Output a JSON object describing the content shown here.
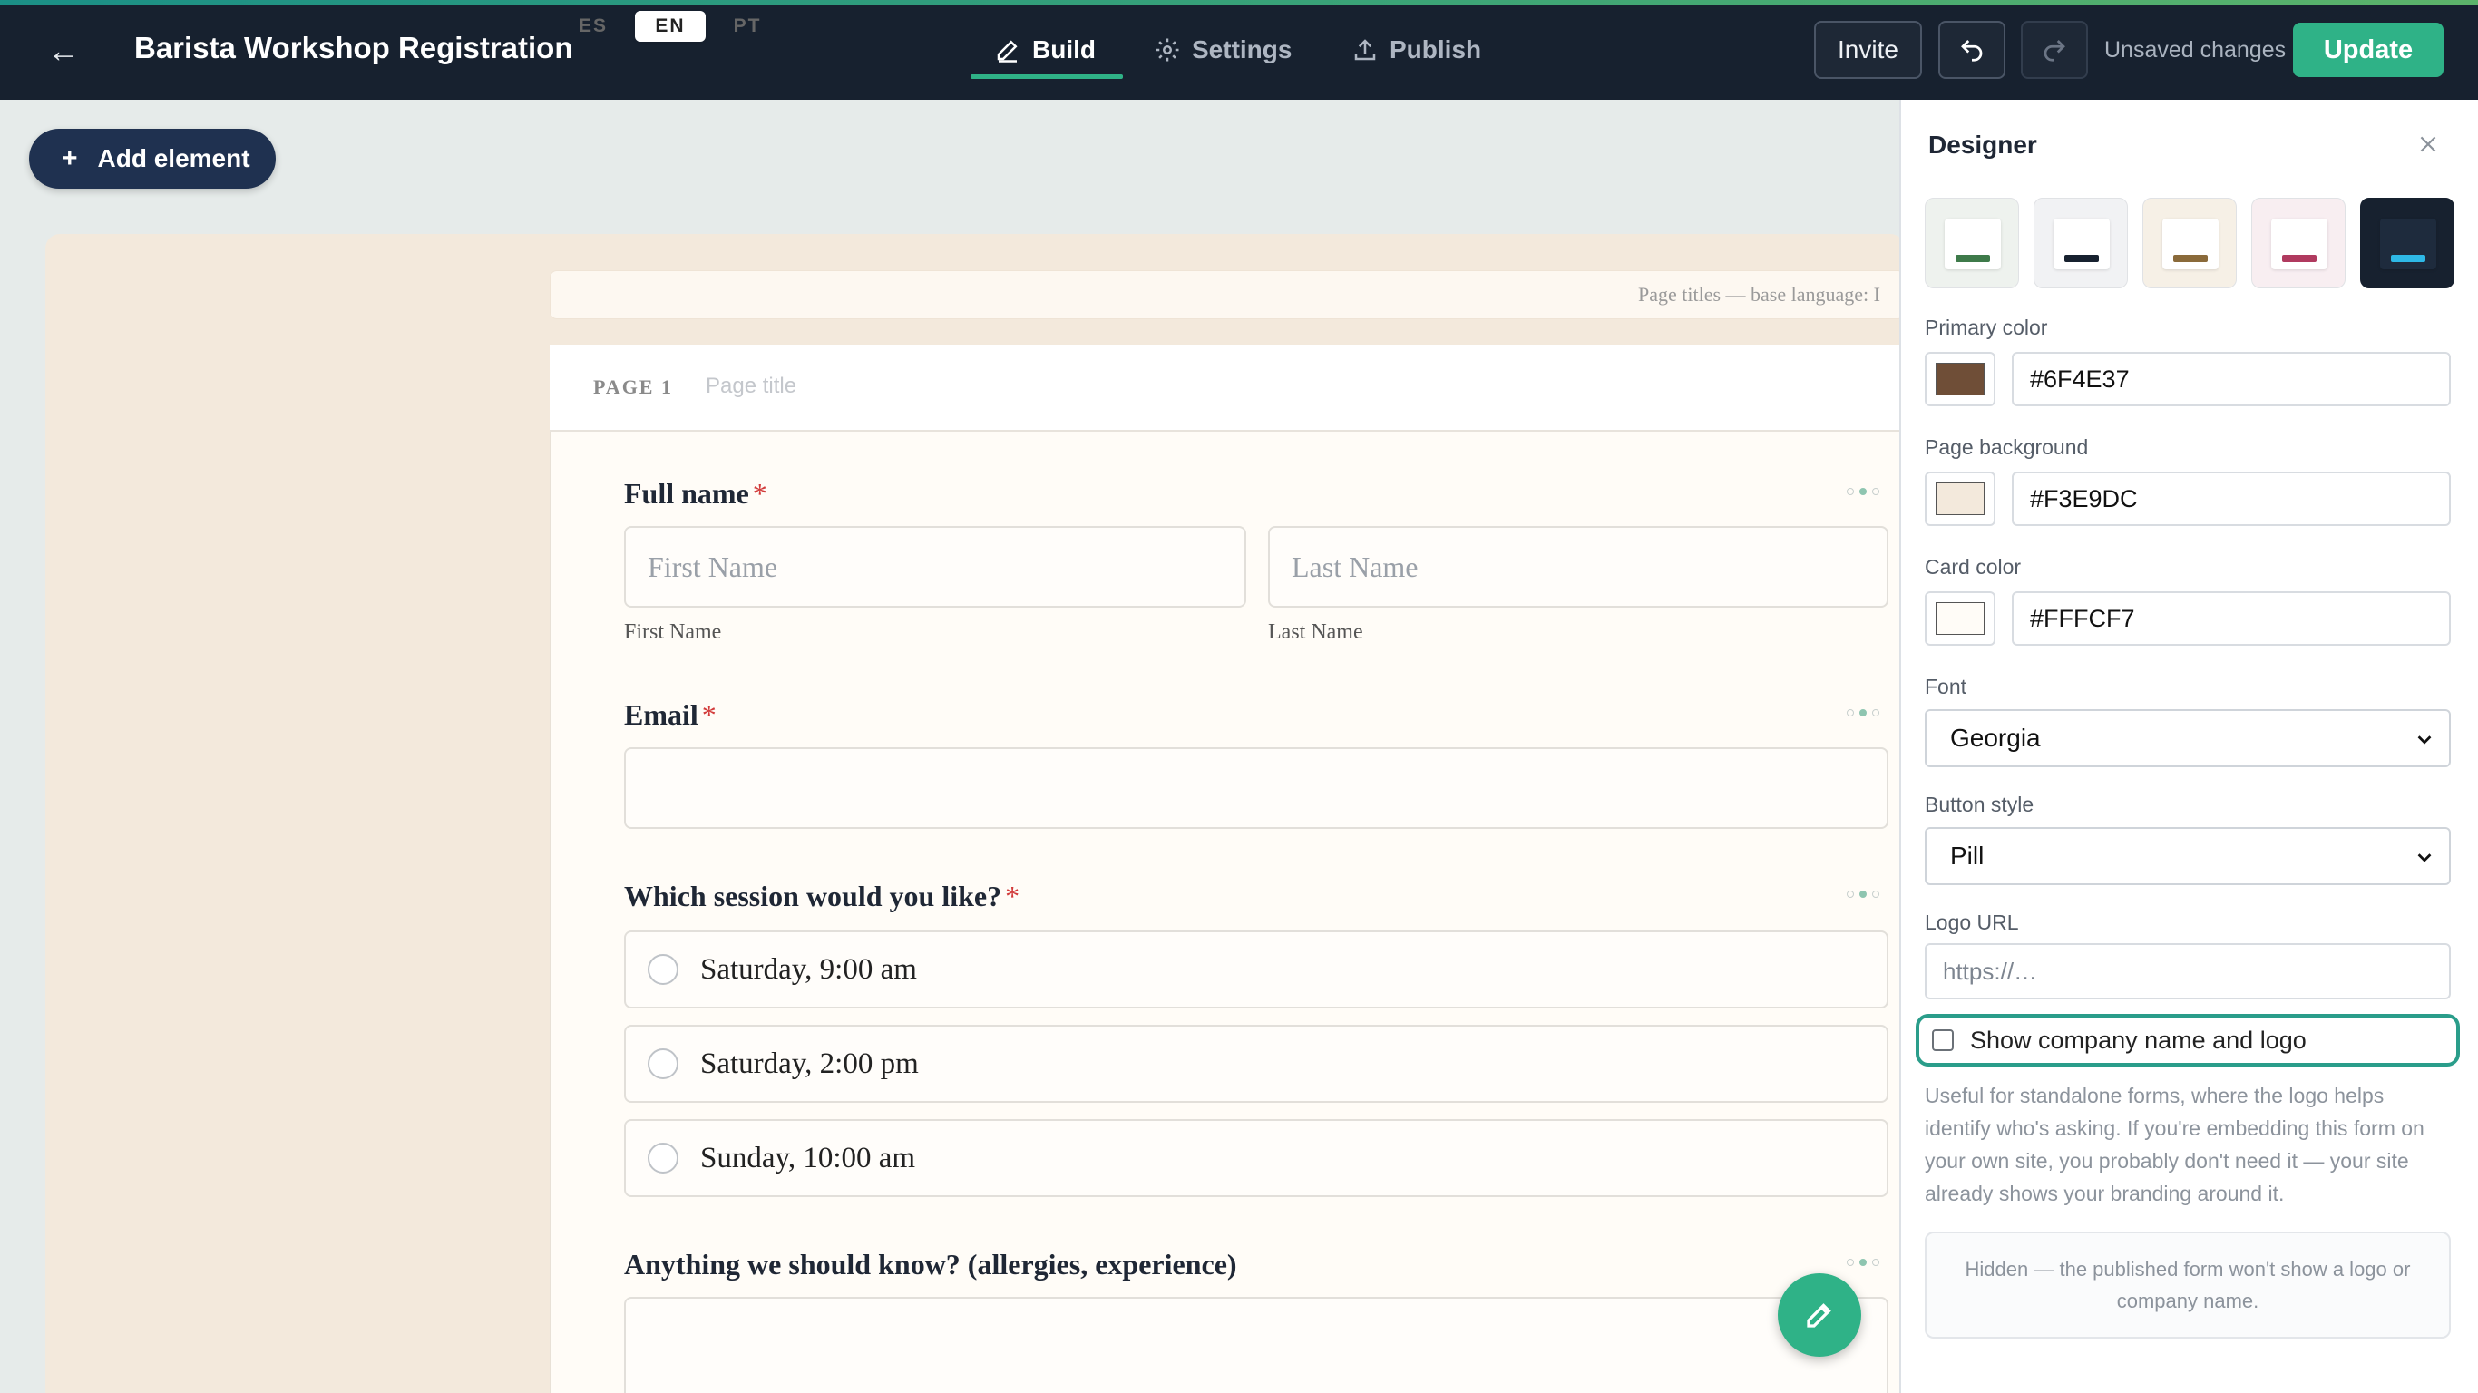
{
  "topbar": {
    "title": "Barista Workshop Registration",
    "tabs": [
      {
        "label": "Build",
        "icon": "pencil-icon",
        "active": true
      },
      {
        "label": "Settings",
        "icon": "gear-icon",
        "active": false
      },
      {
        "label": "Publish",
        "icon": "upload-icon",
        "active": false
      }
    ],
    "invite_label": "Invite",
    "unsaved_text": "Unsaved changes",
    "update_label": "Update",
    "accent_color": "#2FB287"
  },
  "toolbar": {
    "add_element_label": "Add element"
  },
  "language_bar": {
    "languages": [
      "ES",
      "EN",
      "PT"
    ],
    "active": "EN",
    "hint": "Page titles — base language: I"
  },
  "page": {
    "page_label": "PAGE 1",
    "title_placeholder": "Page title"
  },
  "form": {
    "full_name": {
      "label": "Full name",
      "required_mark": "*",
      "first_placeholder": "First Name",
      "last_placeholder": "Last Name",
      "first_sublabel": "First Name",
      "last_sublabel": "Last Name"
    },
    "email": {
      "label": "Email",
      "required_mark": "*"
    },
    "session": {
      "label": "Which session would you like?",
      "required_mark": "*",
      "options": [
        "Saturday, 9:00 am",
        "Saturday, 2:00 pm",
        "Sunday, 10:00 am"
      ]
    },
    "notes": {
      "label": "Anything we should know? (allergies, experience)"
    }
  },
  "designer": {
    "title": "Designer",
    "themes": [
      {
        "name": "green",
        "accent": "#3E7A4A",
        "bg": "#EEF2EE"
      },
      {
        "name": "dark",
        "accent": "#17212F",
        "bg": "#F1F2F4"
      },
      {
        "name": "tan",
        "accent": "#8A6A3A",
        "bg": "#F6F0E6"
      },
      {
        "name": "rose",
        "accent": "#B03A5F",
        "bg": "#F8EEF1"
      },
      {
        "name": "navy",
        "accent": "#2EB8E6",
        "bg": "#17212F"
      }
    ],
    "primary_color_label": "Primary color",
    "primary_color": "#6F4E37",
    "page_background_label": "Page background",
    "page_background": "#F3E9DC",
    "card_color_label": "Card color",
    "card_color": "#FFFCF7",
    "font_label": "Font",
    "font_value": "Georgia",
    "button_style_label": "Button style",
    "button_style_value": "Pill",
    "logo_url_label": "Logo URL",
    "logo_url_placeholder": "https://…",
    "show_logo_label": "Show company name and logo",
    "show_logo_checked": false,
    "help_text": "Useful for standalone forms, where the logo helps identify who's asking. If you're embedding this form on your own site, you probably don't need it — your site already shows your branding around it.",
    "hidden_note": "Hidden — the published form won't show a logo or company name."
  }
}
